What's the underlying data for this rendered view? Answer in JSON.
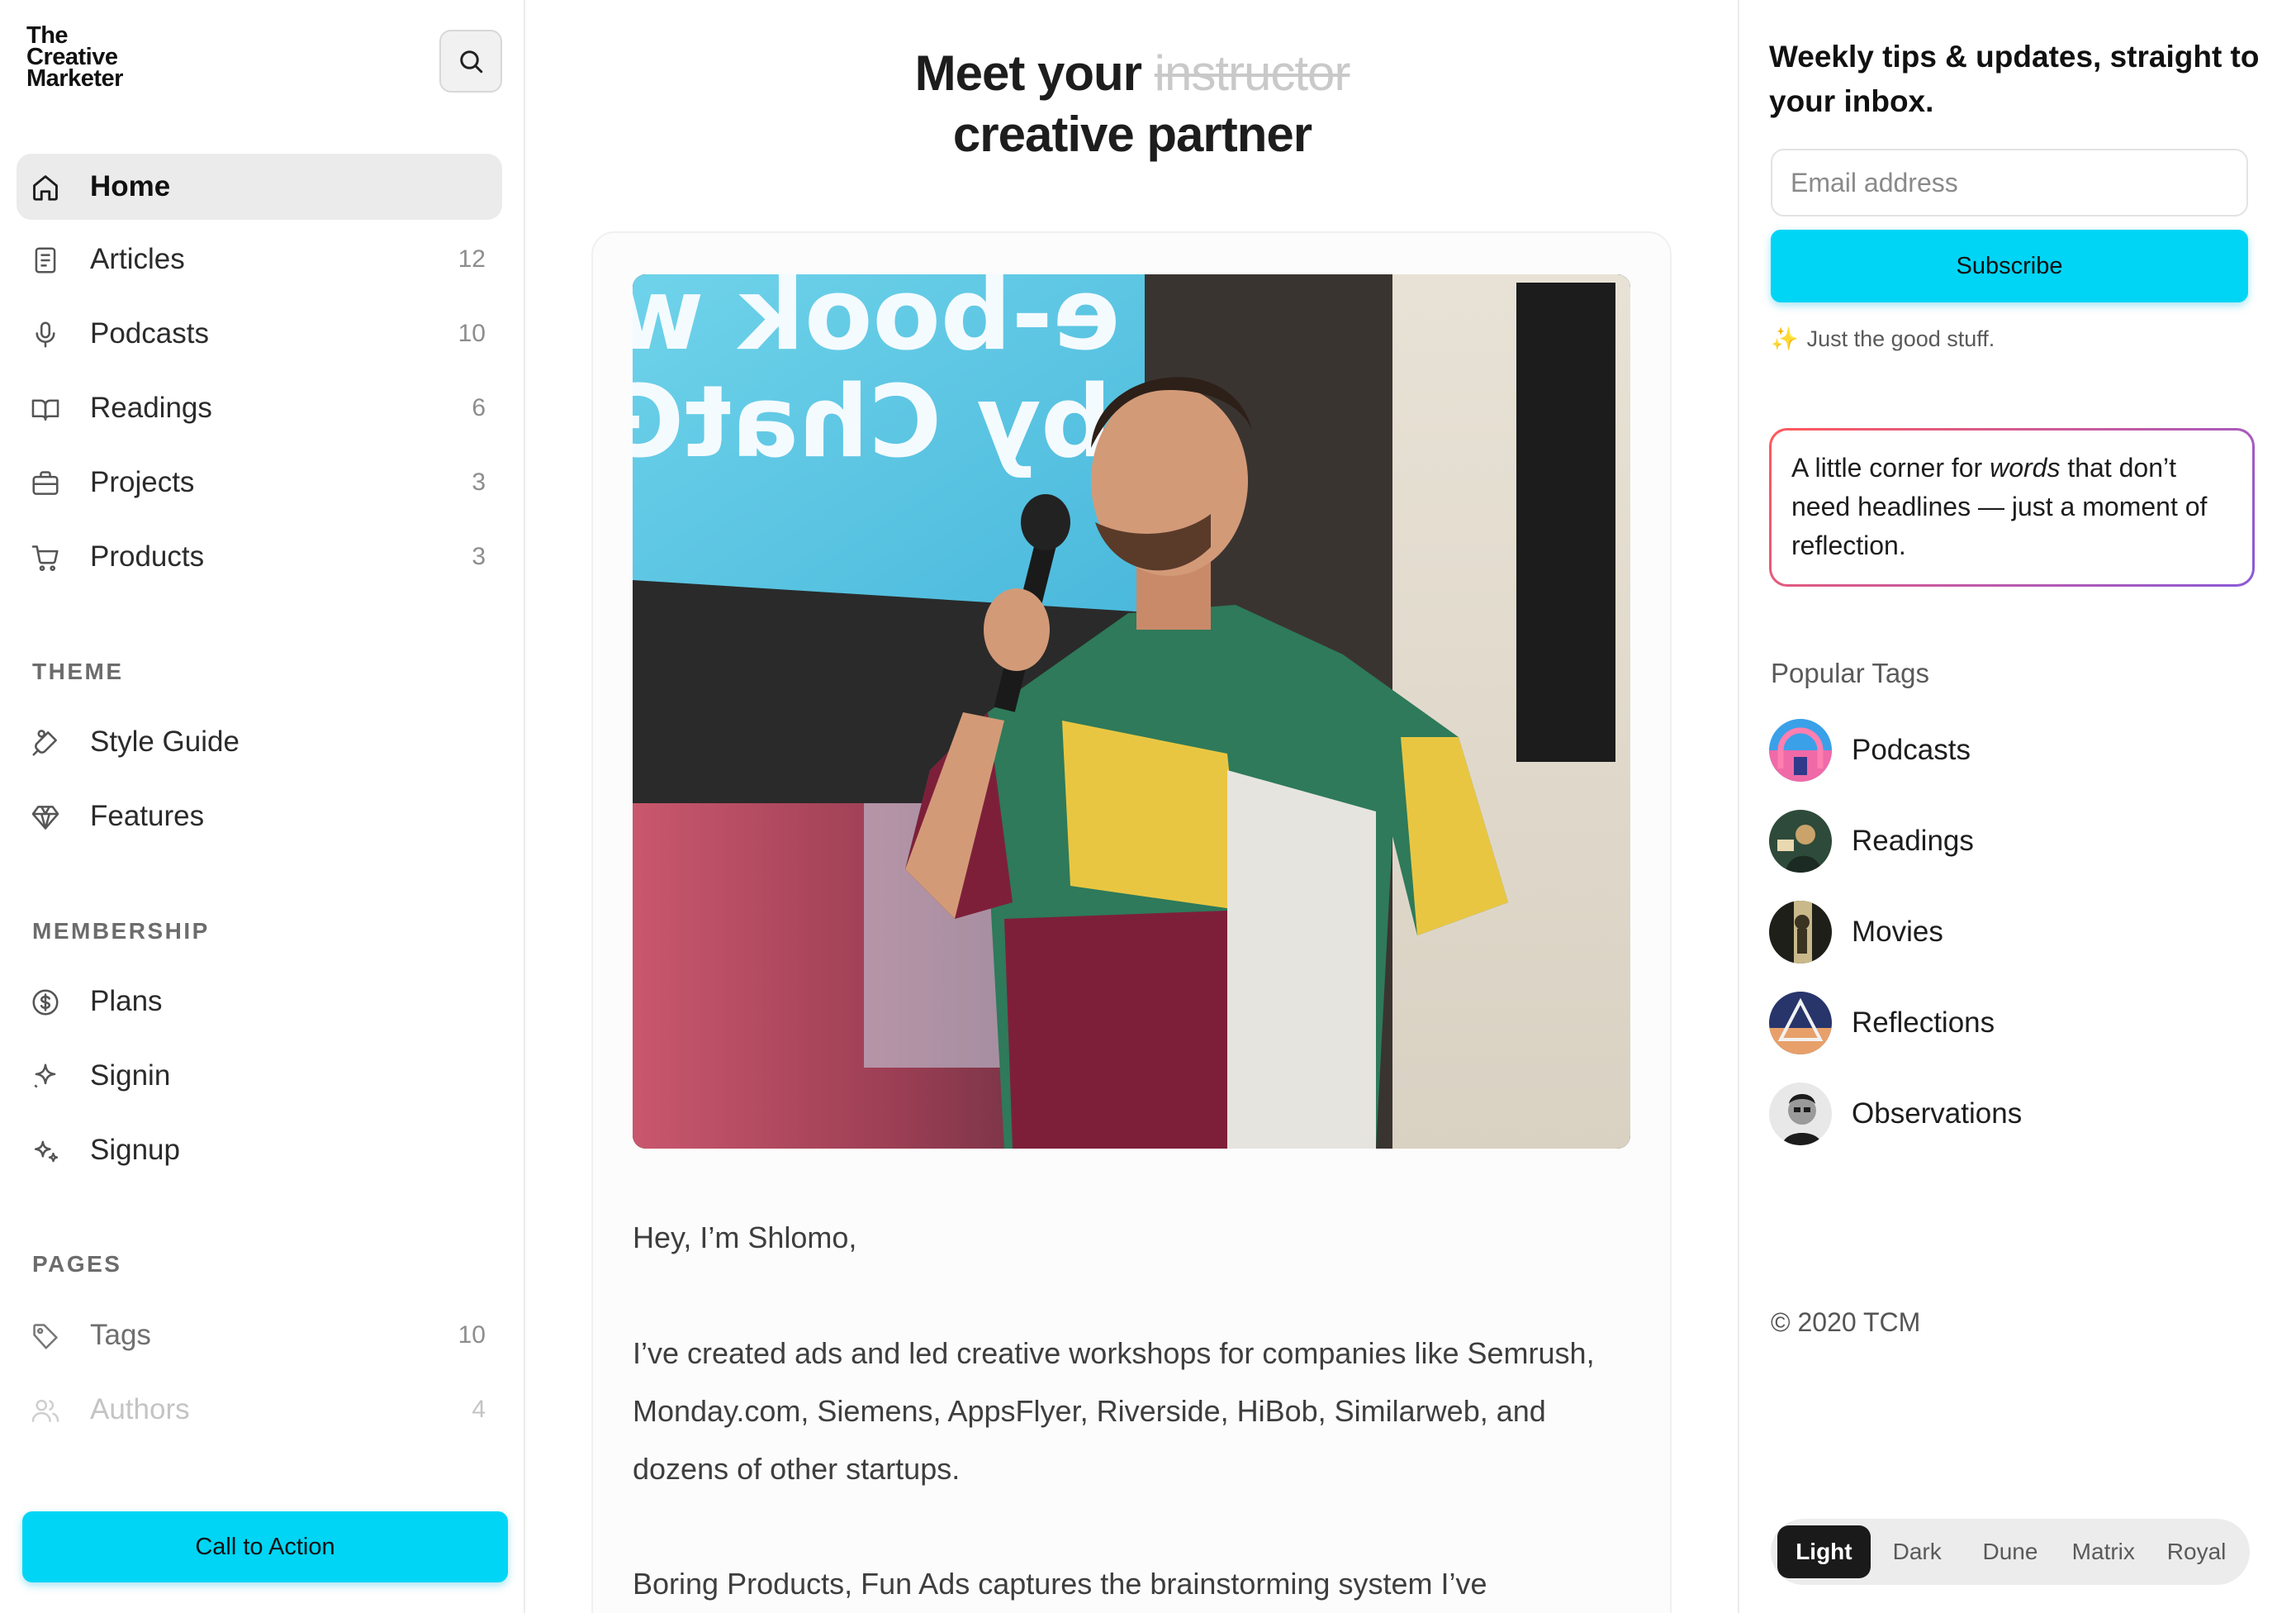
{
  "brand": {
    "logo_lines": [
      "The",
      "Creative",
      "Marketer"
    ]
  },
  "sidebar": {
    "nav": [
      {
        "label": "Home",
        "count": "",
        "icon": "home-icon"
      },
      {
        "label": "Articles",
        "count": "12",
        "icon": "document-icon"
      },
      {
        "label": "Podcasts",
        "count": "10",
        "icon": "microphone-icon"
      },
      {
        "label": "Readings",
        "count": "6",
        "icon": "book-icon"
      },
      {
        "label": "Projects",
        "count": "3",
        "icon": "briefcase-icon"
      },
      {
        "label": "Products",
        "count": "3",
        "icon": "cart-icon"
      }
    ],
    "theme_section": {
      "title": "THEME",
      "items": [
        {
          "label": "Style Guide",
          "icon": "brush-icon"
        },
        {
          "label": "Features",
          "icon": "diamond-icon"
        }
      ]
    },
    "membership_section": {
      "title": "MEMBERSHIP",
      "items": [
        {
          "label": "Plans",
          "icon": "dollar-icon"
        },
        {
          "label": "Signin",
          "icon": "sparkle-icon"
        },
        {
          "label": "Signup",
          "icon": "sparkles-icon"
        }
      ]
    },
    "pages_section": {
      "title": "PAGES",
      "items": [
        {
          "label": "Tags",
          "count": "10",
          "icon": "tag-icon"
        },
        {
          "label": "Authors",
          "count": "4",
          "icon": "users-icon"
        }
      ]
    },
    "cta_label": "Call to Action"
  },
  "main": {
    "heading_prefix": "Meet your",
    "heading_strike": "instructor",
    "heading_line2": "creative partner",
    "photo_sign_line1": "e-book w",
    "photo_sign_line2": "by ChatG",
    "paragraphs": [
      "Hey, I’m Shlomo,",
      "I’ve created ads and led creative workshops for companies like Semrush, Monday.com, Siemens, AppsFlyer, Riverside, HiBob, Similarweb, and dozens of other startups.",
      "Boring Products, Fun Ads captures the brainstorming system I’ve"
    ]
  },
  "newsletter": {
    "title": "Weekly tips & updates, straight to your inbox.",
    "email_placeholder": "Email address",
    "subscribe_label": "Subscribe",
    "note": "Just the good stuff.",
    "note_icon": "sparkle-emoji-icon"
  },
  "quote": {
    "before": "A little corner for ",
    "em": "words",
    "after": " that don’t need headlines — just a moment of reflection."
  },
  "tags": {
    "title": "Popular Tags",
    "items": [
      {
        "label": "Podcasts",
        "colors": [
          "#3aa0e8",
          "#f06aa8"
        ]
      },
      {
        "label": "Readings",
        "colors": [
          "#2e4a3a",
          "#c9a36a"
        ]
      },
      {
        "label": "Movies",
        "colors": [
          "#1f1f1a",
          "#c9b98a"
        ]
      },
      {
        "label": "Reflections",
        "colors": [
          "#27356b",
          "#e8a06a"
        ]
      },
      {
        "label": "Observations",
        "colors": [
          "#e8e8e8",
          "#1c1c1c"
        ]
      }
    ]
  },
  "footer": {
    "copyright": "© 2020 TCM"
  },
  "themes": {
    "options": [
      "Light",
      "Dark",
      "Dune",
      "Matrix",
      "Royal"
    ],
    "selected": "Light"
  },
  "colors": {
    "accent": "#00d5f5",
    "active_nav_bg": "#ebebeb"
  }
}
